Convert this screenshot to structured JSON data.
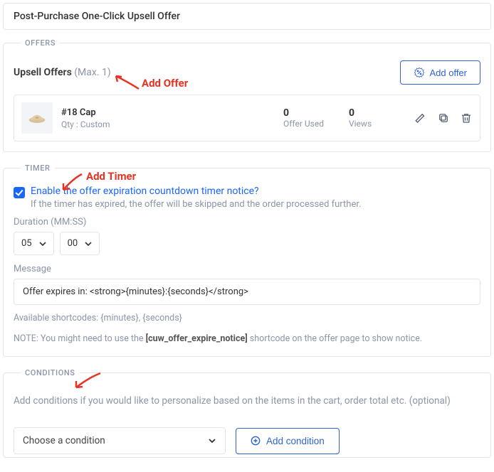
{
  "page_title": "Post-Purchase One-Click Upsell Offer",
  "offers": {
    "legend": "OFFERS",
    "title": "Upsell Offers",
    "max_suffix": " (Max. 1)",
    "add_offer_label": "Add offer",
    "annotation": "Add Offer",
    "items": [
      {
        "name": "#18 Cap",
        "qty_label": "Qty : Custom",
        "offer_used_value": "0",
        "offer_used_label": "Offer Used",
        "views_value": "0",
        "views_label": "Views"
      }
    ]
  },
  "timer": {
    "legend": "TIMER",
    "annotation": "Add Timer",
    "checkbox_label": "Enable the offer expiration countdown timer notice?",
    "checkbox_help": "If the timer has expired, the offer will be skipped and the order processed further.",
    "duration_label": "Duration (MM:SS)",
    "minutes": "05",
    "seconds": "00",
    "message_label": "Message",
    "message_value": "Offer expires in: <strong>{minutes}:{seconds}</strong>",
    "shortcodes_text": "Available shortcodes: {minutes}, {seconds}",
    "note_prefix": "NOTE: You might need to use the ",
    "note_shortcode": "[cuw_offer_expire_notice]",
    "note_suffix": " shortcode on the offer page to show notice."
  },
  "conditions": {
    "legend": "CONDITIONS",
    "description": "Add conditions if you would like to personalize based on the items in the cart, order total etc. (optional)",
    "select_placeholder": "Choose a condition",
    "add_label": "Add condition"
  }
}
